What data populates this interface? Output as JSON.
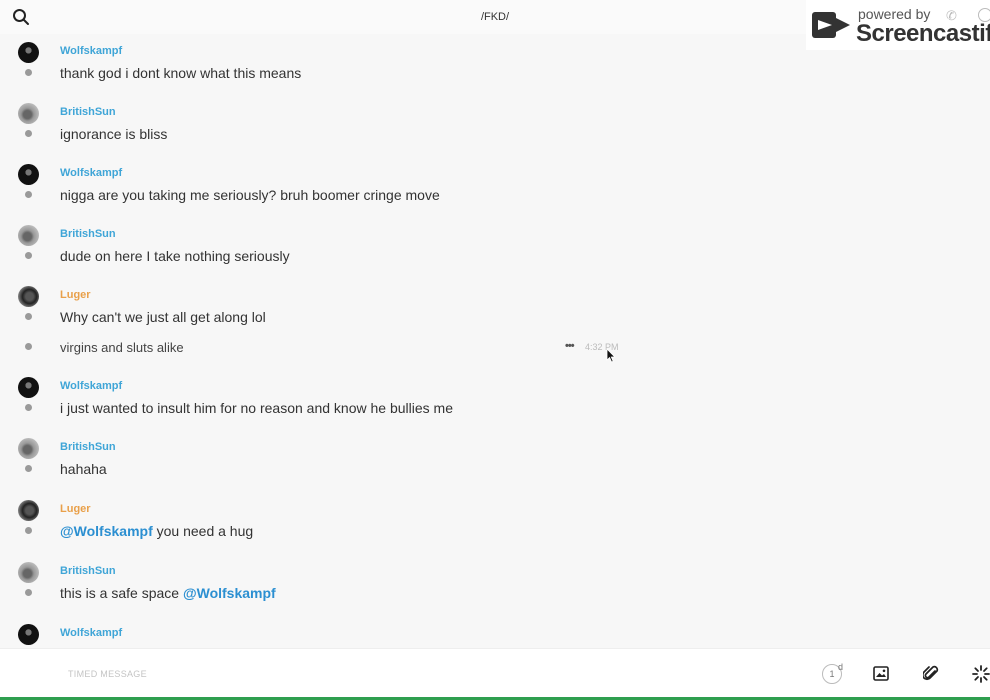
{
  "header": {
    "channel": "/FKD/"
  },
  "watermark": {
    "powered_by": "powered by",
    "brand": "Screencastify"
  },
  "messages": [
    {
      "author": "Wolfskampf",
      "text": "thank god i dont know what this means"
    },
    {
      "author": "BritishSun",
      "text": "ignorance is bliss"
    },
    {
      "author": "Wolfskampf",
      "text": "nigga are you taking me seriously? bruh boomer cringe move"
    },
    {
      "author": "BritishSun",
      "text": "dude on here I take nothing seriously"
    },
    {
      "author": "Luger",
      "text": "Why can't we just all get along lol",
      "followup": "virgins and sluts alike",
      "followup_time": "4:32 PM"
    },
    {
      "author": "Wolfskampf",
      "text": "i just wanted to insult him for no reason and know he bullies me"
    },
    {
      "author": "BritishSun",
      "text": "hahaha"
    },
    {
      "author": "Luger",
      "mention": "@Wolfskampf",
      "text": " you need a hug"
    },
    {
      "author": "BritishSun",
      "text": "this is a safe space ",
      "mention": "@Wolfskampf"
    },
    {
      "author": "Wolfskampf"
    }
  ],
  "composer": {
    "placeholder": "TIMED MESSAGE",
    "timer_value": "1",
    "timer_unit": "d"
  },
  "colors": {
    "author_blue": "#3fa5d7",
    "author_orange": "#e9a04a",
    "mention": "#2b8fd1",
    "bottom_bar": "#2f9f4f"
  }
}
